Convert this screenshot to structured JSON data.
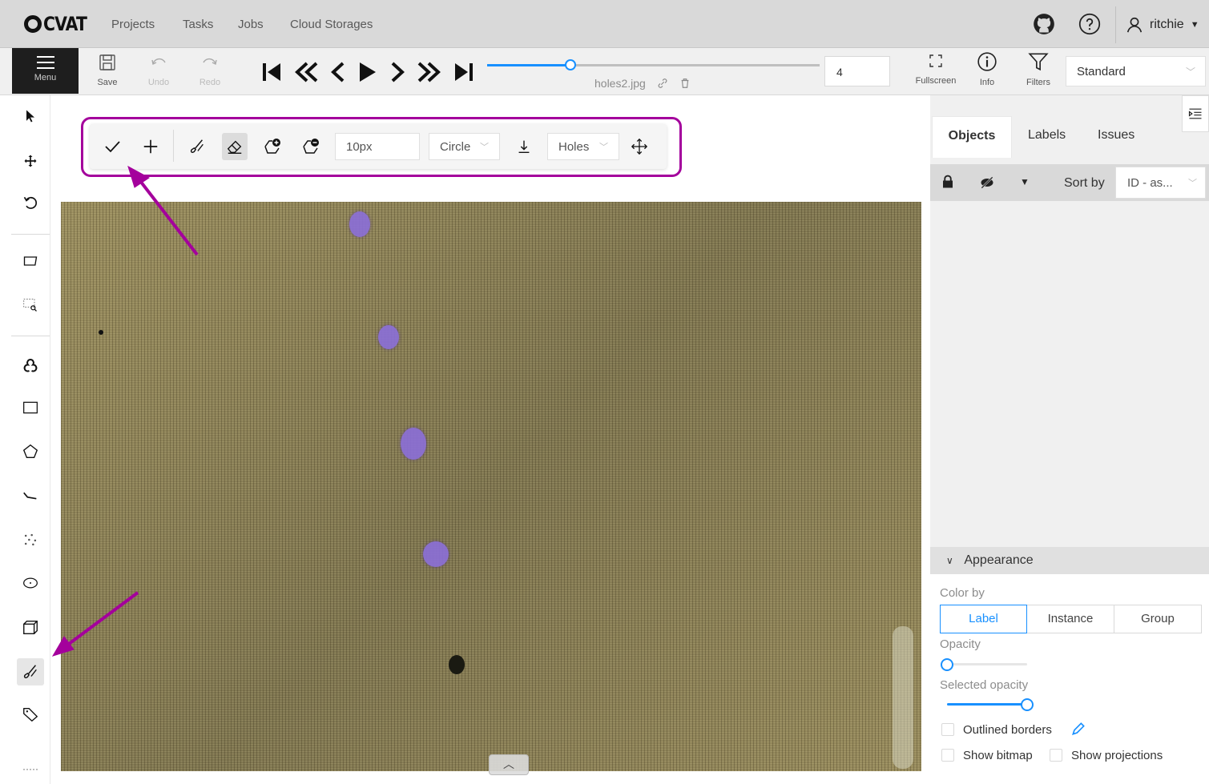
{
  "app": {
    "logo_text": "CVAT",
    "nav": [
      "Projects",
      "Tasks",
      "Jobs",
      "Cloud Storages"
    ],
    "user": "ritchie"
  },
  "toolbar": {
    "menu_label": "Menu",
    "save_label": "Save",
    "undo_label": "Undo",
    "redo_label": "Redo",
    "filename": "holes2.jpg",
    "frame_number": "4",
    "frame_progress": 0.25,
    "fullscreen_label": "Fullscreen",
    "info_label": "Info",
    "filters_label": "Filters",
    "workspace": "Standard"
  },
  "draw_controls": {
    "brush_size": "10px",
    "brush_shape": "Circle",
    "label": "Holes"
  },
  "sidebar": {
    "tabs": [
      "Objects",
      "Labels",
      "Issues"
    ],
    "sort_by_label": "Sort by",
    "sort_value": "ID - as...",
    "appearance": {
      "title": "Appearance",
      "color_by_label": "Color by",
      "color_by_options": [
        "Label",
        "Instance",
        "Group"
      ],
      "selected_color_by": "Label",
      "opacity_label": "Opacity",
      "opacity_value": 0,
      "selected_opacity_label": "Selected opacity",
      "selected_opacity_value": 1.0,
      "outlined_borders_label": "Outlined borders",
      "show_bitmap_label": "Show bitmap",
      "show_projections_label": "Show projections"
    }
  },
  "colors": {
    "accent": "#1890ff",
    "highlight": "#a4009c",
    "mask": "#8b6fd6"
  },
  "icons": {
    "left_tools": [
      "cursor-icon",
      "move-icon",
      "rotate-icon",
      "fit-icon",
      "zoom-region-icon",
      "ai-tools-icon",
      "rectangle-icon",
      "polygon-icon",
      "polyline-icon",
      "points-icon",
      "ellipse-icon",
      "cuboid-icon",
      "brush-icon",
      "tag-icon"
    ]
  }
}
